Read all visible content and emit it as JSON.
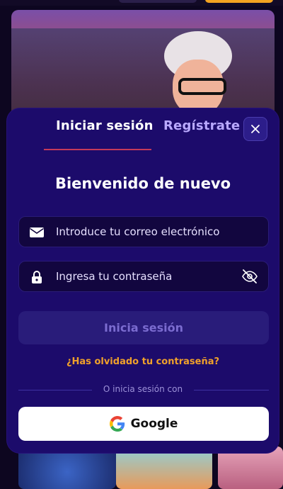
{
  "tabs": {
    "login_label": "Iniciar sesión",
    "register_label": "Regístrate"
  },
  "modal": {
    "title": "Bienvenido de nuevo"
  },
  "email_field": {
    "placeholder": "Introduce tu correo electrónico",
    "icon": "mail-icon"
  },
  "password_field": {
    "placeholder": "Ingresa tu contraseña",
    "icon": "lock-icon",
    "visibility_icon": "eye-off-icon"
  },
  "submit": {
    "label": "Inicia sesión"
  },
  "forgot_password": "¿Has olvidado tu contraseña?",
  "divider_text": "O inicia sesión con",
  "social": {
    "google_label": "Google"
  },
  "colors": {
    "modal_bg": "#1c0b6b",
    "field_bg": "#12063f",
    "accent_link": "#f0a12a",
    "tab_underline": "#c43a5a",
    "submit_disabled_bg": "#291c7a",
    "submit_disabled_text": "#7b6cd0"
  }
}
